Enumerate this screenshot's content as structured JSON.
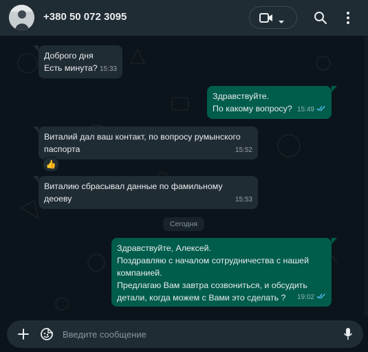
{
  "header": {
    "title": "+380 50 072 3095",
    "icons": [
      "avatar",
      "video-camera-icon",
      "chevron-down-icon",
      "search-icon",
      "more-vertical-icon"
    ]
  },
  "messages": [
    {
      "dir": "in",
      "text": "Доброго дня\nЕсть минута?",
      "time": "15:33"
    },
    {
      "dir": "out",
      "text": "Здравствуйте.\nПо какому вопросу?",
      "time": "15:49",
      "status": "read"
    },
    {
      "dir": "in",
      "text": "Виталий дал ваш контакт, по вопросу румынского\nпаспорта",
      "time": "15:52",
      "reaction": "👍"
    },
    {
      "dir": "in",
      "text": "Виталию сбрасывал данные по фамильному\nдеоеву",
      "time": "15:53"
    },
    {
      "dir": "out",
      "text": "Здравствуйте, Алексей.\nПоздравляю с началом сотрудничества с нашей\nкомпанией.\nПредлагаю Вам завтра созвониться, и обсудить\nдетали, когда можем с Вами это сделать ?",
      "time": "19:02",
      "status": "read"
    }
  ],
  "date_separator": "Сегодня",
  "composer": {
    "placeholder": "Введите сообщение",
    "icons": [
      "plus-icon",
      "emoji-icon",
      "microphone-icon"
    ]
  },
  "colors": {
    "background": "#0b141a",
    "header": "#202c33",
    "incoming_bubble": "#202c33",
    "outgoing_bubble": "#005c4b",
    "read_ticks": "#53bdeb"
  }
}
